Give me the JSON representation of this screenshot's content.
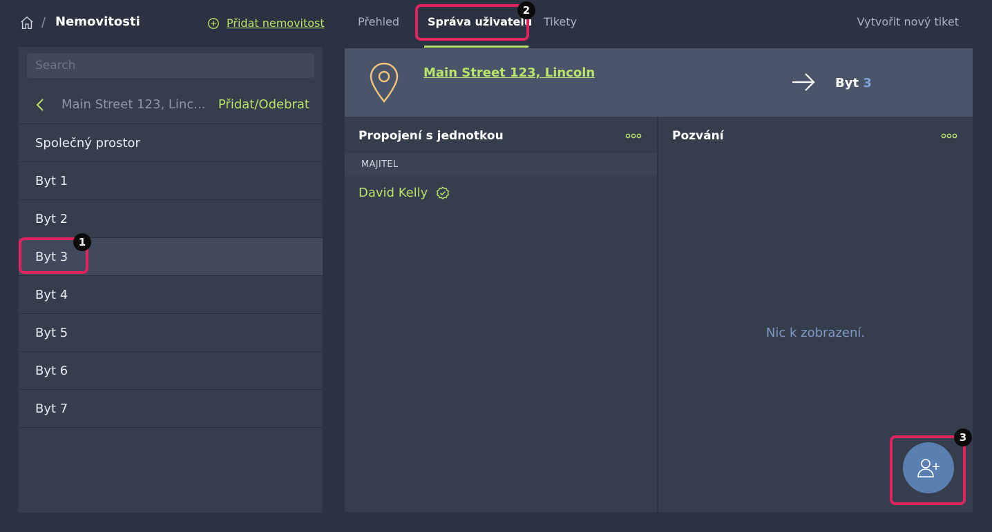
{
  "breadcrumb": {
    "separator": "/",
    "title": "Nemovitosti"
  },
  "actions": {
    "add_property": "Přidat nemovitost",
    "new_ticket": "Vytvořit nový tiket"
  },
  "tabs": [
    {
      "label": "Přehled",
      "active": false
    },
    {
      "label": "Správa uživatelů",
      "active": true
    },
    {
      "label": "Tikety",
      "active": false
    }
  ],
  "sidebar": {
    "search_placeholder": "Search",
    "back_label": "Main Street 123, Linc...",
    "add_remove_label": "Přidat/Odebrat",
    "units": [
      "Společný prostor",
      "Byt 1",
      "Byt 2",
      "Byt 3",
      "Byt 4",
      "Byt 5",
      "Byt 6",
      "Byt 7"
    ],
    "selected_unit": "Byt 3"
  },
  "header": {
    "address": "Main Street 123, Lincoln",
    "unit_prefix": "Byt",
    "unit_number": "3"
  },
  "connections": {
    "title": "Propojení s jednotkou",
    "role": "MAJITEL",
    "member": "David Kelly"
  },
  "invitations": {
    "title": "Pozvání",
    "empty_text": "Nic k zobrazení."
  },
  "annotations": [
    "1",
    "2",
    "3"
  ],
  "colors": {
    "accent": "#b8e36a",
    "highlight": "#e0245e",
    "fab": "#5b7fb0",
    "pin": "#f0c27a"
  },
  "icons": [
    "home-icon",
    "add-circle-icon",
    "chevron-left-icon",
    "location-pin-icon",
    "arrow-right-icon",
    "more-dots-icon",
    "verified-icon",
    "add-user-icon"
  ]
}
